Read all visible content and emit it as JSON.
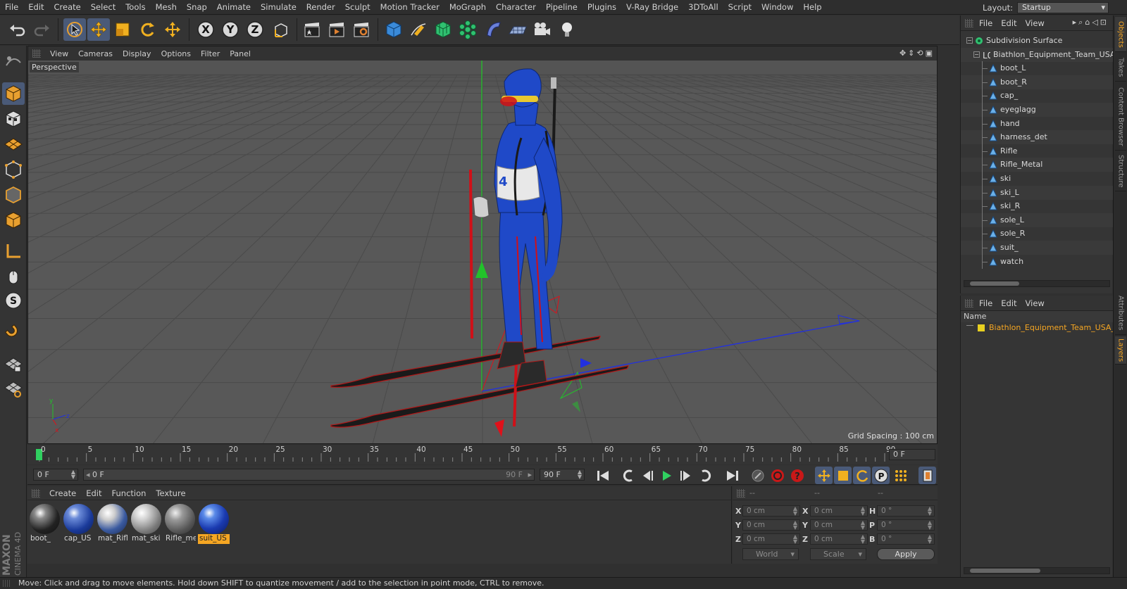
{
  "menubar": {
    "items": [
      "File",
      "Edit",
      "Create",
      "Select",
      "Tools",
      "Mesh",
      "Snap",
      "Animate",
      "Simulate",
      "Render",
      "Sculpt",
      "Motion Tracker",
      "MoGraph",
      "Character",
      "Pipeline",
      "Plugins",
      "V-Ray Bridge",
      "3DToAll",
      "Script",
      "Window",
      "Help"
    ],
    "layout_label": "Layout:",
    "layout_value": "Startup"
  },
  "viewport": {
    "menu": [
      "View",
      "Cameras",
      "Display",
      "Options",
      "Filter",
      "Panel"
    ],
    "camera_label": "Perspective",
    "grid_spacing": "Grid Spacing : 100 cm"
  },
  "timeline": {
    "ticks": [
      "0",
      "5",
      "10",
      "15",
      "20",
      "25",
      "30",
      "35",
      "40",
      "45",
      "50",
      "55",
      "60",
      "65",
      "70",
      "75",
      "80",
      "85",
      "90"
    ],
    "current_frame": "0 F"
  },
  "playbar": {
    "start_field": "0 F",
    "range_start": "0 F",
    "range_end": "90 F",
    "end_field": "90 F"
  },
  "materials": {
    "menu": [
      "Create",
      "Edit",
      "Function",
      "Texture"
    ],
    "items": [
      {
        "name": "boot_",
        "selected": false
      },
      {
        "name": "cap_US",
        "selected": false
      },
      {
        "name": "mat_Rifl",
        "selected": false
      },
      {
        "name": "mat_ski",
        "selected": false
      },
      {
        "name": "Rifle_me",
        "selected": false
      },
      {
        "name": "suit_US",
        "selected": true
      }
    ]
  },
  "coordinates": {
    "headers": [
      "--",
      "--",
      "--"
    ],
    "rows": [
      {
        "a": "X",
        "av": "0 cm",
        "b": "X",
        "bv": "0 cm",
        "c": "H",
        "cv": "0 °"
      },
      {
        "a": "Y",
        "av": "0 cm",
        "b": "Y",
        "bv": "0 cm",
        "c": "P",
        "cv": "0 °"
      },
      {
        "a": "Z",
        "av": "0 cm",
        "b": "Z",
        "bv": "0 cm",
        "c": "B",
        "cv": "0 °"
      }
    ],
    "mode": "World",
    "scale_mode": "Scale",
    "apply_label": "Apply"
  },
  "objects": {
    "menu": [
      "File",
      "Edit",
      "View"
    ],
    "root": "Subdivision Surface",
    "group": "Biathlon_Equipment_Team_USA_",
    "children": [
      "boot_L",
      "boot_R",
      "cap_",
      "eyeglagg",
      "hand",
      "harness_det",
      "Rifle",
      "Rifle_Metal",
      "ski",
      "ski_L",
      "ski_R",
      "sole_L",
      "sole_R",
      "suit_",
      "watch"
    ]
  },
  "layers": {
    "menu": [
      "File",
      "Edit",
      "View"
    ],
    "column_name": "Name",
    "layer_name": "Biathlon_Equipment_Team_USA_S"
  },
  "side_tabs": [
    "Objects",
    "Takes",
    "Content Browser",
    "Structure",
    "Attributes",
    "Layers"
  ],
  "brand": {
    "line1": "MAXON",
    "line2": "CINEMA 4D"
  },
  "status": "Move: Click and drag to move elements. Hold down SHIFT to quantize movement / add to the selection in point mode, CTRL to remove.",
  "colors": {
    "accent": "#f5a623",
    "suit_blue": "#1f49c8",
    "gizmo_red": "#e0101a",
    "gizmo_green": "#22c22a",
    "gizmo_blue": "#2230e0"
  }
}
